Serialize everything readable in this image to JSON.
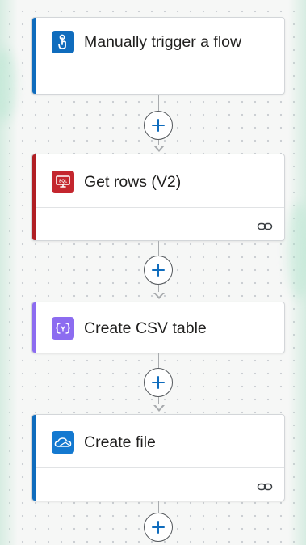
{
  "canvas": {
    "steps": [
      {
        "id": "trigger",
        "title": "Manually trigger a flow",
        "icon": "touch-hand-icon",
        "accent": "#0f6cbd",
        "icon_bg": "#0f6cbd",
        "has_footer": false
      },
      {
        "id": "get-rows",
        "title": "Get rows (V2)",
        "icon": "sql-server-icon",
        "accent": "#b01e23",
        "icon_bg": "#c4262e",
        "has_footer": true,
        "footer_icon": "link-icon"
      },
      {
        "id": "create-csv",
        "title": "Create CSV table",
        "icon": "data-operation-icon",
        "accent": "#8c6cf0",
        "icon_bg": "#8c6cf0",
        "has_footer": false
      },
      {
        "id": "create-file",
        "title": "Create file",
        "icon": "onedrive-icon",
        "accent": "#0f6cbd",
        "icon_bg": "#1479d0",
        "has_footer": true,
        "footer_icon": "link-icon"
      }
    ],
    "add_button_icon": "plus-icon"
  }
}
